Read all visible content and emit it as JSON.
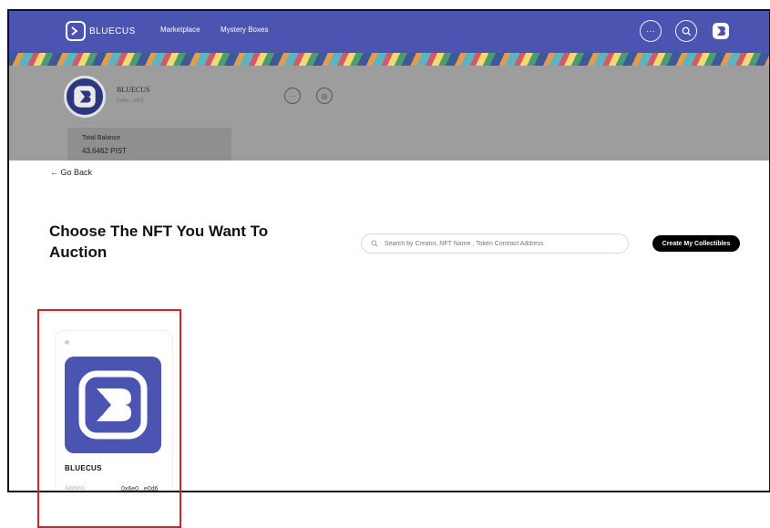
{
  "header": {
    "brand_name": "BLUECUS",
    "nav_links": [
      "Marketplace",
      "Mystery Boxes"
    ],
    "more_icon": "ellipsis-icon",
    "search_icon": "search-icon",
    "profile_icon": "bluecus-logo-icon"
  },
  "profile": {
    "name": "BLUECUS",
    "subtitle": "0x6e...#4cf",
    "balance_label": "Total Balance",
    "balance_value": "43.6462 PIST"
  },
  "page": {
    "back_label": "← Go Back",
    "title": "Choose The NFT You Want To Auction",
    "search_placeholder": "Search by Creator, NFT Name , Token Contract Address",
    "create_button": "Create My Collectibles"
  },
  "nft_cards": [
    {
      "name": "BLUECUS",
      "meta_left": "Address",
      "meta_right": "0x6e0...e0d6"
    }
  ],
  "colors": {
    "brand": "#4b54b1",
    "highlight": "#d6212b"
  }
}
